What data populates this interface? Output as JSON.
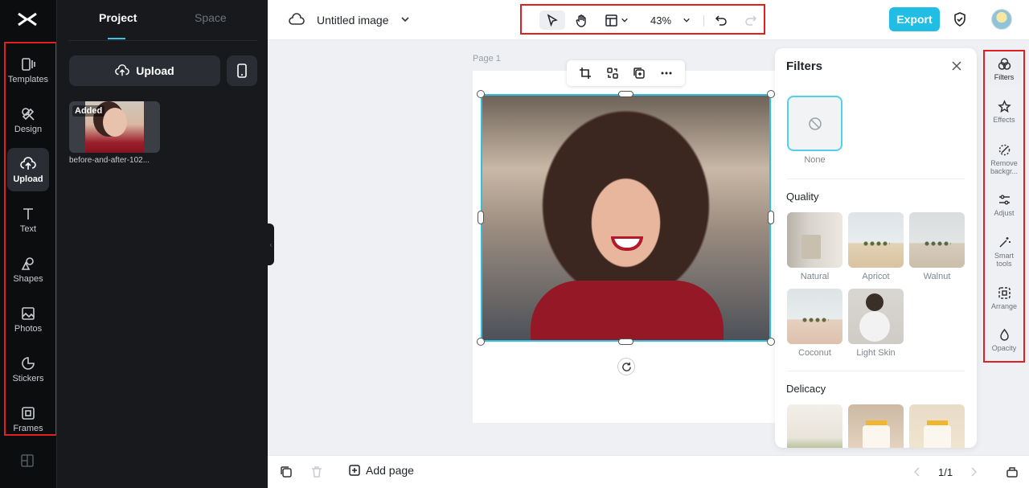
{
  "sidebar": {
    "items": [
      {
        "label": "Templates",
        "icon": "templates-icon"
      },
      {
        "label": "Design",
        "icon": "design-icon"
      },
      {
        "label": "Upload",
        "icon": "upload-icon",
        "active": true
      },
      {
        "label": "Text",
        "icon": "text-icon"
      },
      {
        "label": "Shapes",
        "icon": "shapes-icon"
      },
      {
        "label": "Photos",
        "icon": "photos-icon"
      },
      {
        "label": "Stickers",
        "icon": "stickers-icon"
      },
      {
        "label": "Frames",
        "icon": "frames-icon"
      }
    ]
  },
  "panel": {
    "tabs": [
      "Project",
      "Space"
    ],
    "upload_label": "Upload",
    "media": [
      {
        "badge": "Added",
        "name": "before-and-after-102..."
      }
    ]
  },
  "header": {
    "title": "Untitled image",
    "zoom": "43%",
    "export_label": "Export"
  },
  "canvas": {
    "page_label": "Page 1"
  },
  "filters": {
    "title": "Filters",
    "none_label": "None",
    "sections": [
      {
        "title": "Quality",
        "items": [
          "Natural",
          "Apricot",
          "Walnut",
          "Coconut",
          "Light Skin"
        ]
      },
      {
        "title": "Delicacy",
        "items": [
          "",
          "",
          ""
        ]
      }
    ]
  },
  "right_tools": [
    {
      "label": "Filters",
      "active": true
    },
    {
      "label": "Effects"
    },
    {
      "label": "Remove backgr..."
    },
    {
      "label": "Adjust"
    },
    {
      "label": "Smart tools"
    },
    {
      "label": "Arrange"
    },
    {
      "label": "Opacity"
    }
  ],
  "bottom": {
    "add_page_label": "Add page",
    "pager": "1/1"
  },
  "colors": {
    "accent": "#21bde4",
    "highlight_box": "#e02020",
    "selection": "#2bc0e0"
  }
}
